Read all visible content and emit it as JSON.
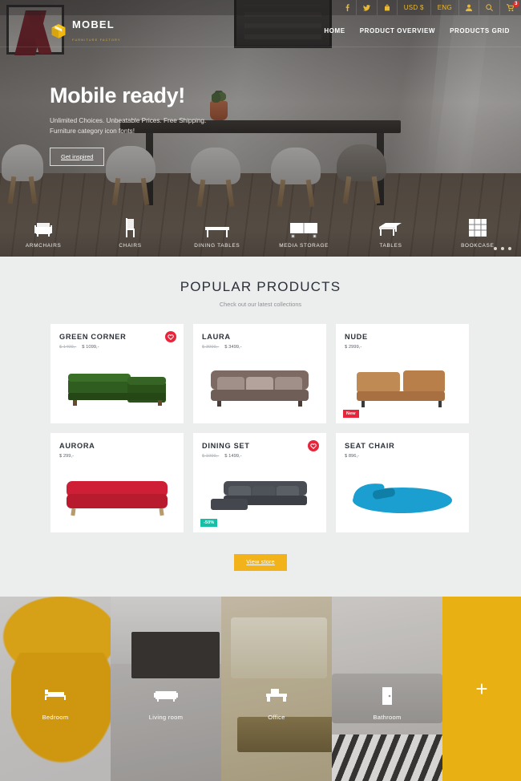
{
  "topbar": {
    "icons": [
      {
        "name": "facebook-icon",
        "label": "f"
      },
      {
        "name": "twitter-icon",
        "label": ""
      },
      {
        "name": "bag-icon",
        "label": ""
      }
    ],
    "currency": "USD $",
    "language": "ENG",
    "account_icon": "user-icon",
    "search_icon": "search-icon",
    "cart_icon": "cart-icon",
    "cart_count": "3"
  },
  "brand": {
    "name": "MOBEL",
    "tagline": "FURNITURE FACTORY",
    "logo_icon": "box-logo-icon"
  },
  "nav": {
    "items": [
      {
        "label": "HOME"
      },
      {
        "label": "PRODUCT OVERVIEW"
      },
      {
        "label": "PRODUCTS GRID"
      }
    ]
  },
  "hero": {
    "title": "Mobile ready!",
    "subtitle_line1": "Unlimited Choices. Unbeatable Prices. Free Shipping.",
    "subtitle_line2": "Furniture category icon fonts!",
    "cta": "Get inspired",
    "slider_dots": 3
  },
  "categories": [
    {
      "label": "ARMCHAIRS",
      "icon": "armchair-icon"
    },
    {
      "label": "CHAIRS",
      "icon": "chair-icon"
    },
    {
      "label": "DINING TABLES",
      "icon": "dining-table-icon"
    },
    {
      "label": "MEDIA STORAGE",
      "icon": "media-storage-icon"
    },
    {
      "label": "TABLES",
      "icon": "table-icon"
    },
    {
      "label": "BOOKCASE",
      "icon": "bookcase-icon"
    }
  ],
  "popular": {
    "title": "POPULAR PRODUCTS",
    "subtitle": "Check out our latest collections",
    "view_store": "View store",
    "products": [
      {
        "name": "GREEN CORNER",
        "old_price": "$ 1499,-",
        "price": "$ 1099,-",
        "wishlist": true,
        "badge": "",
        "color": "#2f5d1f"
      },
      {
        "name": "LAURA",
        "old_price": "$ 3999,-",
        "price": "$ 3499,-",
        "wishlist": false,
        "badge": "",
        "color": "#8e7a72"
      },
      {
        "name": "NUDE",
        "old_price": "",
        "price": "$ 2999,-",
        "wishlist": false,
        "badge": "New",
        "color": "#c08a55"
      },
      {
        "name": "AURORA",
        "old_price": "",
        "price": "$ 299,-",
        "wishlist": false,
        "badge": "",
        "color": "#cf1f36"
      },
      {
        "name": "DINING SET",
        "old_price": "$ 1999,-",
        "price": "$ 1499,-",
        "wishlist": true,
        "badge": "-50%",
        "color": "#3c3f44"
      },
      {
        "name": "SEAT CHAIR",
        "old_price": "",
        "price": "$ 896,-",
        "wishlist": false,
        "badge": "",
        "color": "#1a9fd0"
      }
    ]
  },
  "rooms": [
    {
      "label": "Bedroom",
      "icon": "bed-icon"
    },
    {
      "label": "Living room",
      "icon": "sofa-icon"
    },
    {
      "label": "Office",
      "icon": "desk-icon"
    },
    {
      "label": "Bathroom",
      "icon": "door-icon"
    }
  ],
  "rooms_more": "+",
  "colors": {
    "accent_yellow": "#f2b31a",
    "badge_red": "#e8253a",
    "badge_teal": "#17bfa6",
    "section_bg": "#eceded"
  }
}
